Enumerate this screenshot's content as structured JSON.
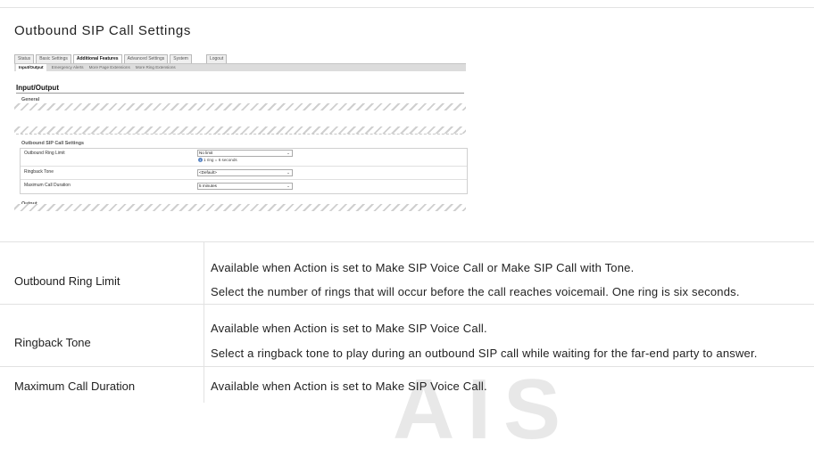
{
  "doc_title": "Outbound SIP Call Settings",
  "screenshot": {
    "main_tabs": [
      {
        "label": "Status",
        "active": false
      },
      {
        "label": "Basic Settings",
        "active": false
      },
      {
        "label": "Additional Features",
        "active": true
      },
      {
        "label": "Advanced Settings",
        "active": false
      },
      {
        "label": "System",
        "active": false
      },
      {
        "label": "Logout",
        "active": false
      }
    ],
    "sub_tabs": [
      {
        "label": "Input/Output",
        "active": true
      },
      {
        "label": "Emergency Alerts",
        "active": false
      },
      {
        "label": "More Page Extensions",
        "active": false
      },
      {
        "label": "More Ring Extensions",
        "active": false
      }
    ],
    "section_heading": "Input/Output",
    "general_label": "General",
    "settings_title": "Outbound SIP Call Settings",
    "output_label": "Output",
    "settings": [
      {
        "label": "Outbound Ring Limit",
        "value": "No limit",
        "hint": "1 ring = 6 seconds"
      },
      {
        "label": "Ringback Tone",
        "value": "<Default>"
      },
      {
        "label": "Maximum Call Duration",
        "value": "5 minutes"
      }
    ]
  },
  "table": {
    "rows": [
      {
        "label": "Outbound Ring Limit",
        "lines": [
          "Available when Action is set to Make SIP Voice Call or Make SIP Call with Tone.",
          "Select the number of rings that will occur before the call reaches voicemail. One ring is six seconds."
        ]
      },
      {
        "label": "Ringback Tone",
        "lines": [
          "Available when Action is set to Make SIP Voice Call.",
          "Select a ringback tone to play during an outbound SIP call while waiting for the far-end party to answer."
        ]
      },
      {
        "label": "Maximum Call Duration",
        "lines": [
          "Available when Action is set to Make SIP Voice Call."
        ]
      }
    ]
  },
  "watermark_text": "AIS"
}
